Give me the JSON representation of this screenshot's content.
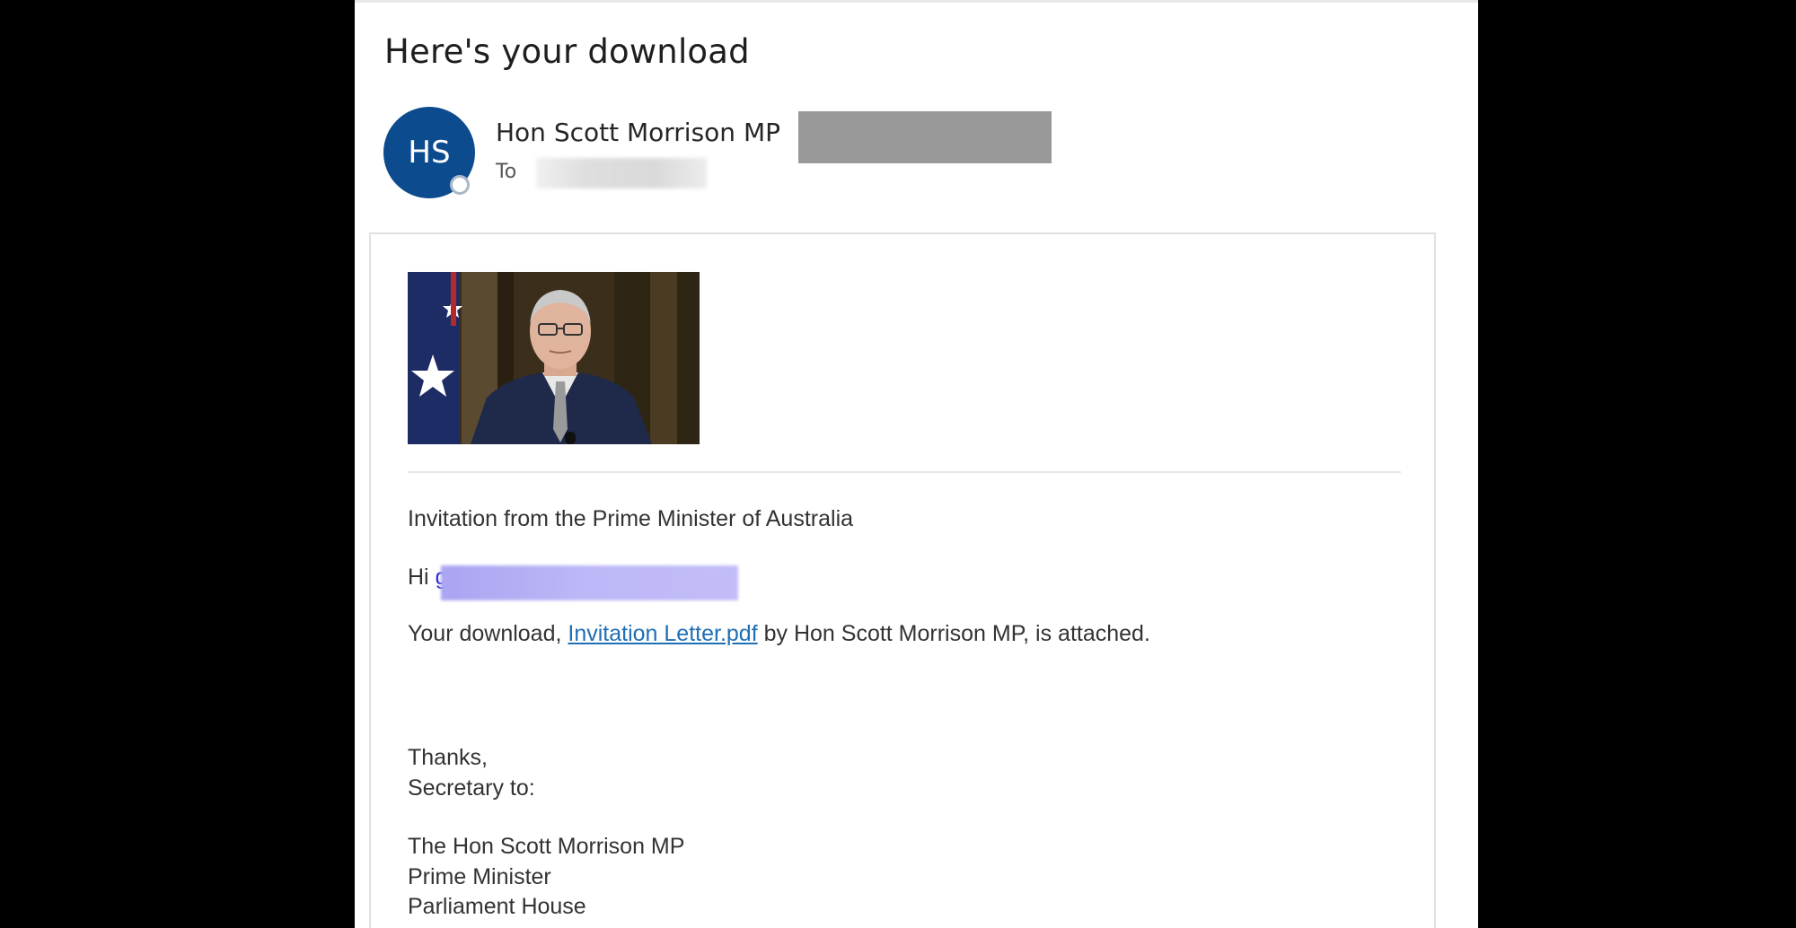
{
  "email": {
    "subject": "Here's your download",
    "sender": {
      "initials": "HS",
      "name": "Hon Scott Morrison MP",
      "avatar_color": "#0d4b8f"
    },
    "recipient_label": "To",
    "body": {
      "invitation_line": "Invitation from the Prime Minister of Australia",
      "greeting_prefix": "Hi",
      "greeting_link_visible_char": "g",
      "download_prefix": "Your download,",
      "attachment_link": "Invitation Letter.pdf",
      "download_suffix": "by Hon Scott Morrison MP, is attached.",
      "sign_off": "Thanks,",
      "secretary_line": "Secretary to:",
      "signature": {
        "title_name": "The Hon Scott Morrison MP",
        "role": "Prime Minister",
        "address": "Parliament House"
      }
    }
  }
}
